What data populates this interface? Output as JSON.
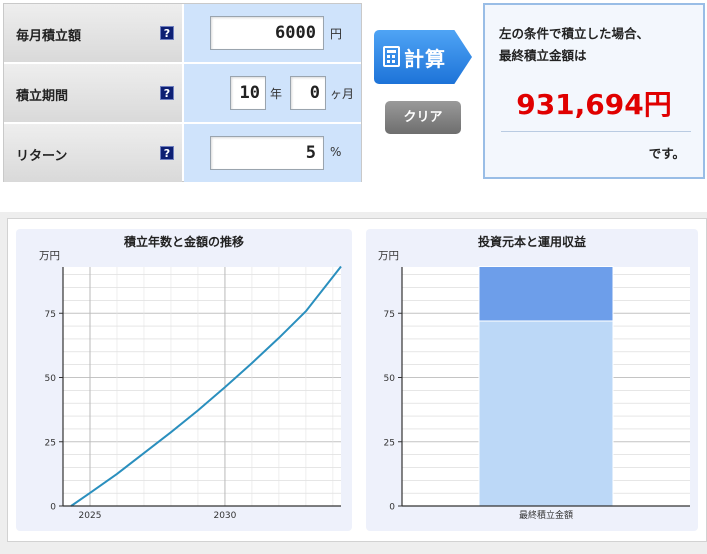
{
  "form": {
    "monthly": {
      "label": "毎月積立額",
      "value": "6000",
      "unit": "円"
    },
    "period": {
      "label": "積立期間",
      "years": "10",
      "years_unit": "年",
      "months": "0",
      "months_unit": "ヶ月"
    },
    "return": {
      "label": "リターン",
      "value": "5",
      "unit": "%"
    },
    "help_glyph": "?"
  },
  "buttons": {
    "calculate": "計算",
    "clear": "クリア"
  },
  "result": {
    "line1": "左の条件で積立した場合、",
    "line2": "最終積立金額は",
    "amount": "931,694円",
    "suffix": "です。"
  },
  "colors": {
    "accent_blue": "#1d73d8",
    "result_red": "#e00000",
    "line_series": "#2a8fbe",
    "principal_bar": "#bcd8f7",
    "earnings_bar": "#6d9eea"
  },
  "chart_data": [
    {
      "type": "line",
      "title": "積立年数と金額の推移",
      "ylabel": "万円",
      "ylim": [
        0,
        93
      ],
      "yticks": [
        0,
        25,
        50,
        75
      ],
      "xlim": [
        2024,
        2034.3
      ],
      "xticks": [
        2025,
        2030
      ],
      "x": [
        2024.3,
        2025,
        2026,
        2027,
        2028,
        2029,
        2030,
        2031,
        2032,
        2033,
        2034.3
      ],
      "y": [
        0,
        5.1,
        12.5,
        20.6,
        28.7,
        37.2,
        46.2,
        55.6,
        65.4,
        75.8,
        93.2
      ],
      "grid": true
    },
    {
      "type": "bar",
      "title": "投資元本と運用収益",
      "ylabel": "万円",
      "ylim": [
        0,
        93
      ],
      "yticks": [
        0,
        25,
        50,
        75
      ],
      "categories": [
        "最終積立金額"
      ],
      "series": [
        {
          "values": [
            72
          ]
        },
        {
          "values": [
            21.2
          ]
        }
      ],
      "grid": true
    }
  ]
}
